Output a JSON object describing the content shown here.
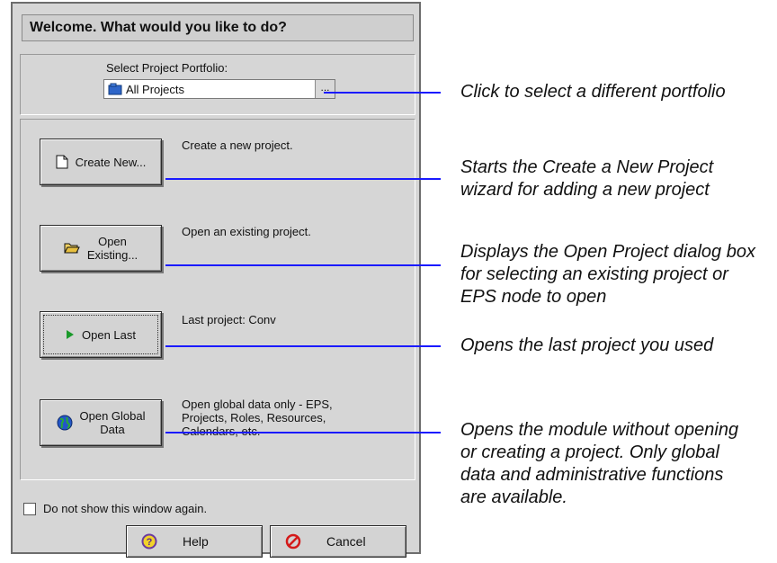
{
  "dialog": {
    "title": "Welcome. What would you like to do?",
    "portfolio": {
      "label": "Select Project Portfolio:",
      "value": "All Projects",
      "browse_label": "..."
    },
    "actions": [
      {
        "button": "Create New...",
        "description": "Create a new project."
      },
      {
        "button_line1": "Open",
        "button_line2": "Existing...",
        "description": "Open an existing project."
      },
      {
        "button": "Open Last",
        "description": "Last project: Conv"
      },
      {
        "button_line1": "Open Global",
        "button_line2": "Data",
        "description": "Open global data only - EPS, Projects, Roles, Resources, Calendars, etc."
      }
    ],
    "checkbox_label": "Do not show this window again.",
    "help_label": "Help",
    "cancel_label": "Cancel"
  },
  "annotations": {
    "portfolio": "Click to select a different portfolio",
    "create": "Starts the Create a New Project wizard for adding a new project",
    "open": "Displays the Open Project dialog box for selecting an existing project or EPS node to open",
    "last": "Opens the last project you used",
    "global": "Opens the module without opening or creating a project. Only global data and administrative functions are available."
  },
  "colors": {
    "callout_line": "#1a1aff",
    "dialog_bg": "#d6d6d6"
  }
}
